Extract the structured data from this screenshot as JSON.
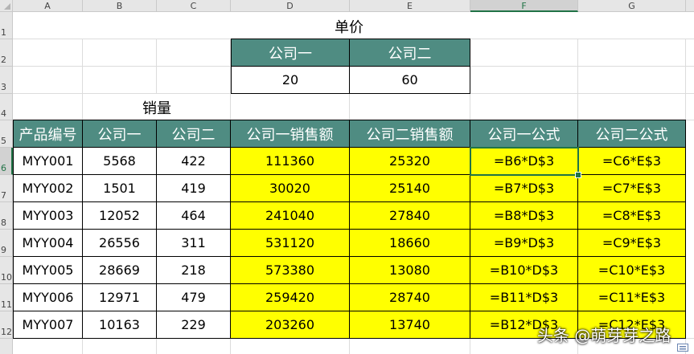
{
  "columns": [
    "A",
    "B",
    "C",
    "D",
    "E",
    "F",
    "G"
  ],
  "rows": [
    "1",
    "2",
    "3",
    "4",
    "5",
    "6",
    "7",
    "8",
    "9",
    "10",
    "11",
    "12"
  ],
  "active_cell": {
    "column": "F",
    "row": "6"
  },
  "price_table": {
    "title": "单价",
    "headers": [
      "公司一",
      "公司二"
    ],
    "values": [
      "20",
      "60"
    ]
  },
  "sales_table": {
    "title": "销量",
    "headers": [
      "产品编号",
      "公司一",
      "公司二",
      "公司一销售额",
      "公司二销售额",
      "公司一公式",
      "公司二公式"
    ],
    "rows": [
      [
        "MYY001",
        "5568",
        "422",
        "111360",
        "25320",
        "=B6*D$3",
        "=C6*E$3"
      ],
      [
        "MYY002",
        "1501",
        "419",
        "30020",
        "25140",
        "=B7*D$3",
        "=C7*E$3"
      ],
      [
        "MYY003",
        "12052",
        "464",
        "241040",
        "27840",
        "=B8*D$3",
        "=C8*E$3"
      ],
      [
        "MYY004",
        "26556",
        "311",
        "531120",
        "18660",
        "=B9*D$3",
        "=C9*E$3"
      ],
      [
        "MYY005",
        "28669",
        "218",
        "573380",
        "13080",
        "=B10*D$3",
        "=C10*E$3"
      ],
      [
        "MYY006",
        "12971",
        "479",
        "259420",
        "28740",
        "=B11*D$3",
        "=C11*E$3"
      ],
      [
        "MYY007",
        "10163",
        "229",
        "203260",
        "13740",
        "=B12*D$3",
        "=C12*E$3"
      ]
    ]
  },
  "colors": {
    "header_fill": "#4f8c82",
    "highlight_fill": "#ffff00",
    "selection": "#217346"
  },
  "watermark": "头条 @萌芽芽之路"
}
